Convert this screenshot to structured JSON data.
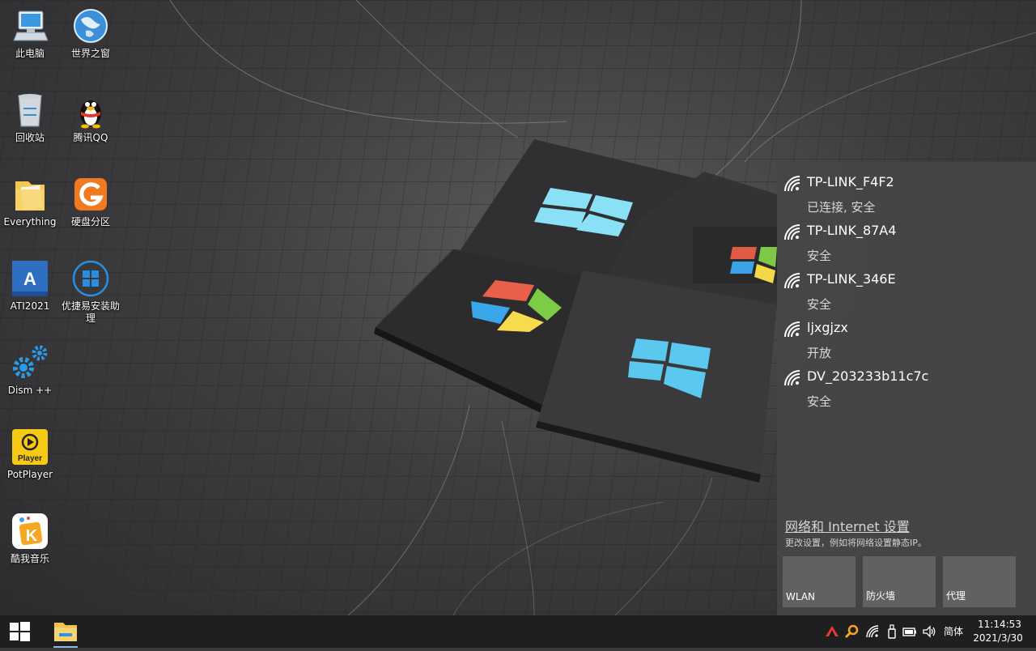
{
  "desktop": {
    "icons": [
      {
        "label": "此电脑",
        "icon": "computer-icon"
      },
      {
        "label": "世界之窗",
        "icon": "globe-icon"
      },
      {
        "label": "回收站",
        "icon": "recycle-bin-icon"
      },
      {
        "label": "腾讯QQ",
        "icon": "qq-penguin-icon"
      },
      {
        "label": "Everything",
        "icon": "everything-folder-icon"
      },
      {
        "label": "硬盘分区",
        "icon": "diskgenius-icon"
      },
      {
        "label": "ATI2021",
        "icon": "acronis-icon",
        "glyph": "A"
      },
      {
        "label": "优捷易安装助理",
        "icon": "windows-logo-icon"
      },
      {
        "label": "Dism ++",
        "icon": "gears-icon"
      },
      {
        "label": "PotPlayer",
        "icon": "potplayer-icon",
        "glyph": "Player"
      },
      {
        "label": "酷我音乐",
        "icon": "kuwo-music-icon",
        "glyph": "K"
      }
    ]
  },
  "network_flyout": {
    "networks": [
      {
        "ssid": "TP-LINK_F4F2",
        "state": "已连接, 安全"
      },
      {
        "ssid": "TP-LINK_87A4",
        "state": "安全"
      },
      {
        "ssid": "TP-LINK_346E",
        "state": "安全"
      },
      {
        "ssid": "ljxgjzx",
        "state": "开放"
      },
      {
        "ssid": "DV_203233b11c7c",
        "state": "安全"
      }
    ],
    "settings_link": "网络和 Internet 设置",
    "settings_desc": "更改设置，例如将网络设置静态IP。",
    "quick_actions": [
      "WLAN",
      "防火墙",
      "代理"
    ]
  },
  "taskbar": {
    "ime": "简体",
    "time": "11:14:53",
    "date": "2021/3/30",
    "tray_icons": [
      "network-up-arrow-icon",
      "search-magnifier-icon",
      "wifi-icon",
      "usb-icon",
      "battery-icon",
      "volume-icon"
    ]
  },
  "colors": {
    "accent_blue": "#2b8de0",
    "taskbar": "#1f1f21",
    "flyout": "#464648"
  }
}
